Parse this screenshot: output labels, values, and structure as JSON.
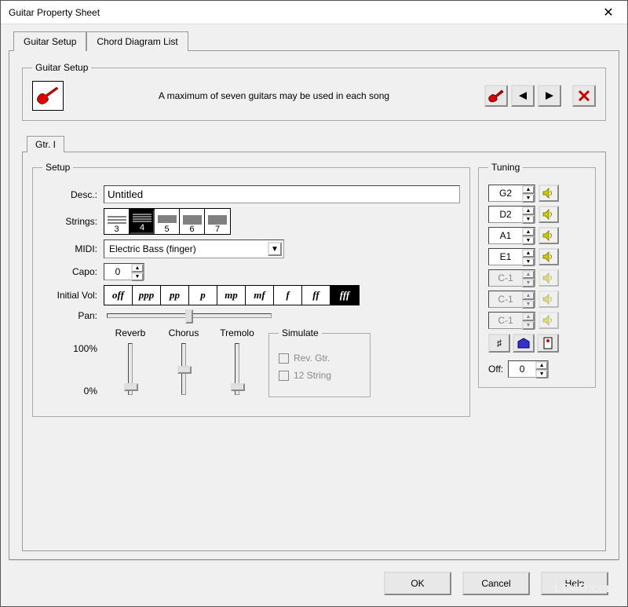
{
  "window": {
    "title": "Guitar Property Sheet"
  },
  "tabs": [
    {
      "label": "Guitar Setup"
    },
    {
      "label": "Chord Diagram List"
    }
  ],
  "groupbox": {
    "label": "Guitar Setup",
    "message": "A maximum of seven guitars may be used in each song"
  },
  "inner_tab": {
    "label": "Gtr. I"
  },
  "setup": {
    "legend": "Setup",
    "desc_label": "Desc.:",
    "desc_value": "Untitled",
    "strings_label": "Strings:",
    "strings_options": [
      "3",
      "4",
      "5",
      "6",
      "7"
    ],
    "strings_selected_index": 1,
    "midi_label": "MIDI:",
    "midi_value": "Electric Bass (finger)",
    "capo_label": "Capo:",
    "capo_value": "0",
    "initvol_label": "Initial Vol:",
    "vol_options": [
      "off",
      "ppp",
      "pp",
      "p",
      "mp",
      "mf",
      "f",
      "ff",
      "fff"
    ],
    "vol_selected_index": 8,
    "pan_label": "Pan:",
    "effects": {
      "reverb": "Reverb",
      "chorus": "Chorus",
      "tremolo": "Tremolo"
    },
    "effects_100": "100%",
    "effects_0": "0%",
    "simulate": {
      "legend": "Simulate",
      "rev": "Rev. Gtr.",
      "twelve": "12 String"
    }
  },
  "tuning": {
    "legend": "Tuning",
    "notes": [
      {
        "v": "G2",
        "enabled": true
      },
      {
        "v": "D2",
        "enabled": true
      },
      {
        "v": "A1",
        "enabled": true
      },
      {
        "v": "E1",
        "enabled": true
      },
      {
        "v": "C-1",
        "enabled": false
      },
      {
        "v": "C-1",
        "enabled": false
      },
      {
        "v": "C-1",
        "enabled": false
      }
    ],
    "off_label": "Off:",
    "off_value": "0"
  },
  "buttons": {
    "ok": "OK",
    "cancel": "Cancel",
    "help": "Help"
  },
  "watermark": "LO4D.com"
}
